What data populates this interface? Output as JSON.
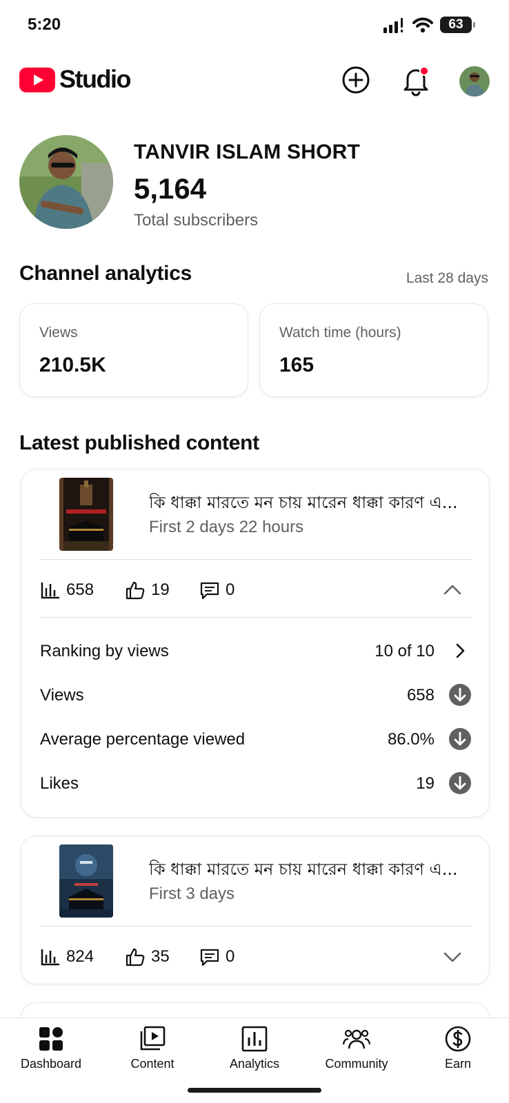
{
  "status_bar": {
    "time": "5:20",
    "battery": "63",
    "icons": [
      "signal-icon",
      "wifi-icon",
      "battery-icon"
    ]
  },
  "header": {
    "brand": "Studio",
    "brand_color": "#ff0033",
    "notification_dot_color": "#ff0033",
    "icons": [
      "youtube-logo-icon",
      "create-plus-icon",
      "notification-bell-icon",
      "avatar"
    ]
  },
  "channel": {
    "name": "TANVIR ISLAM SHORT",
    "subscribers": "5,164",
    "subscribers_label": "Total subscribers"
  },
  "analytics": {
    "title": "Channel analytics",
    "range": "Last 28 days",
    "metrics": [
      {
        "label": "Views",
        "value": "210.5K"
      },
      {
        "label": "Watch time (hours)",
        "value": "165"
      }
    ]
  },
  "latest": {
    "title": "Latest published content",
    "items": [
      {
        "title": "কি ধাক্কা মারতে মন চায় মারেন ধাক্কা কারণ এ...",
        "meta": "First 2 days 22 hours",
        "views": "658",
        "likes": "19",
        "comments": "0",
        "expanded": true,
        "details": [
          {
            "label": "Ranking by views",
            "value": "10 of 10",
            "icon": "chevron-right-icon"
          },
          {
            "label": "Views",
            "value": "658",
            "icon": "arrow-down-circle-icon"
          },
          {
            "label": "Average percentage viewed",
            "value": "86.0%",
            "icon": "arrow-down-circle-icon"
          },
          {
            "label": "Likes",
            "value": "19",
            "icon": "arrow-down-circle-icon"
          }
        ]
      },
      {
        "title": "কি ধাক্কা মারতে মন চায় মারেন ধাক্কা কারণ এ...",
        "meta": "First 3 days",
        "views": "824",
        "likes": "35",
        "comments": "0",
        "expanded": false
      }
    ]
  },
  "nav": [
    {
      "label": "Dashboard",
      "icon": "dashboard-icon",
      "active": true
    },
    {
      "label": "Content",
      "icon": "content-icon"
    },
    {
      "label": "Analytics",
      "icon": "analytics-icon"
    },
    {
      "label": "Community",
      "icon": "community-icon"
    },
    {
      "label": "Earn",
      "icon": "earn-dollar-icon"
    }
  ]
}
